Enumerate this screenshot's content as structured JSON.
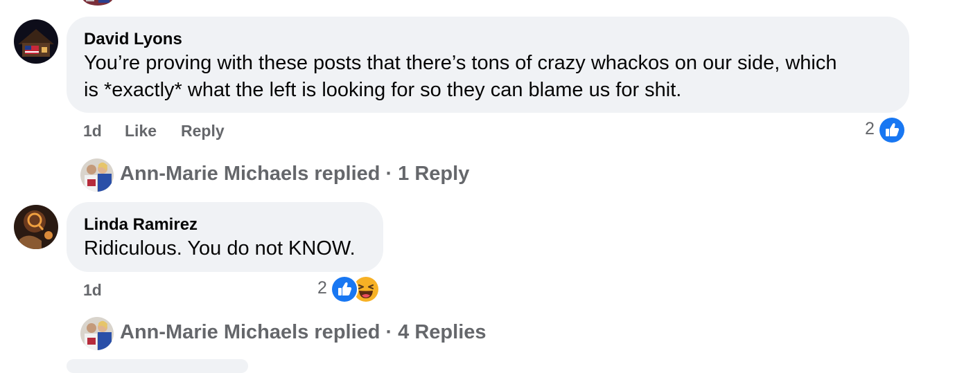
{
  "comments": [
    {
      "author": "David Lyons",
      "text_line1": "You’re proving with these posts that there’s tons of crazy whackos on our side, which",
      "text_line2": "is *exactly* what the left is looking for so they can blame us for shit.",
      "time": "1d",
      "like_label": "Like",
      "reply_label": "Reply",
      "reaction_count": "2",
      "reactions": [
        "like-icon"
      ],
      "replied": {
        "name": "Ann-Marie Michaels replied",
        "separator": "·",
        "count": "1 Reply"
      }
    },
    {
      "author": "Linda Ramirez",
      "text_line1": "Ridiculous. You do not KNOW.",
      "time": "1d",
      "reaction_count": "2",
      "reactions": [
        "like-icon",
        "haha-icon"
      ],
      "replied": {
        "name": "Ann-Marie Michaels replied",
        "separator": "·",
        "count": "4 Replies"
      }
    }
  ],
  "colors": {
    "bubble": "#f0f2f5",
    "secondary_text": "#65676b",
    "like_blue": "#1877f2",
    "haha_yellow": "#f7b125"
  }
}
